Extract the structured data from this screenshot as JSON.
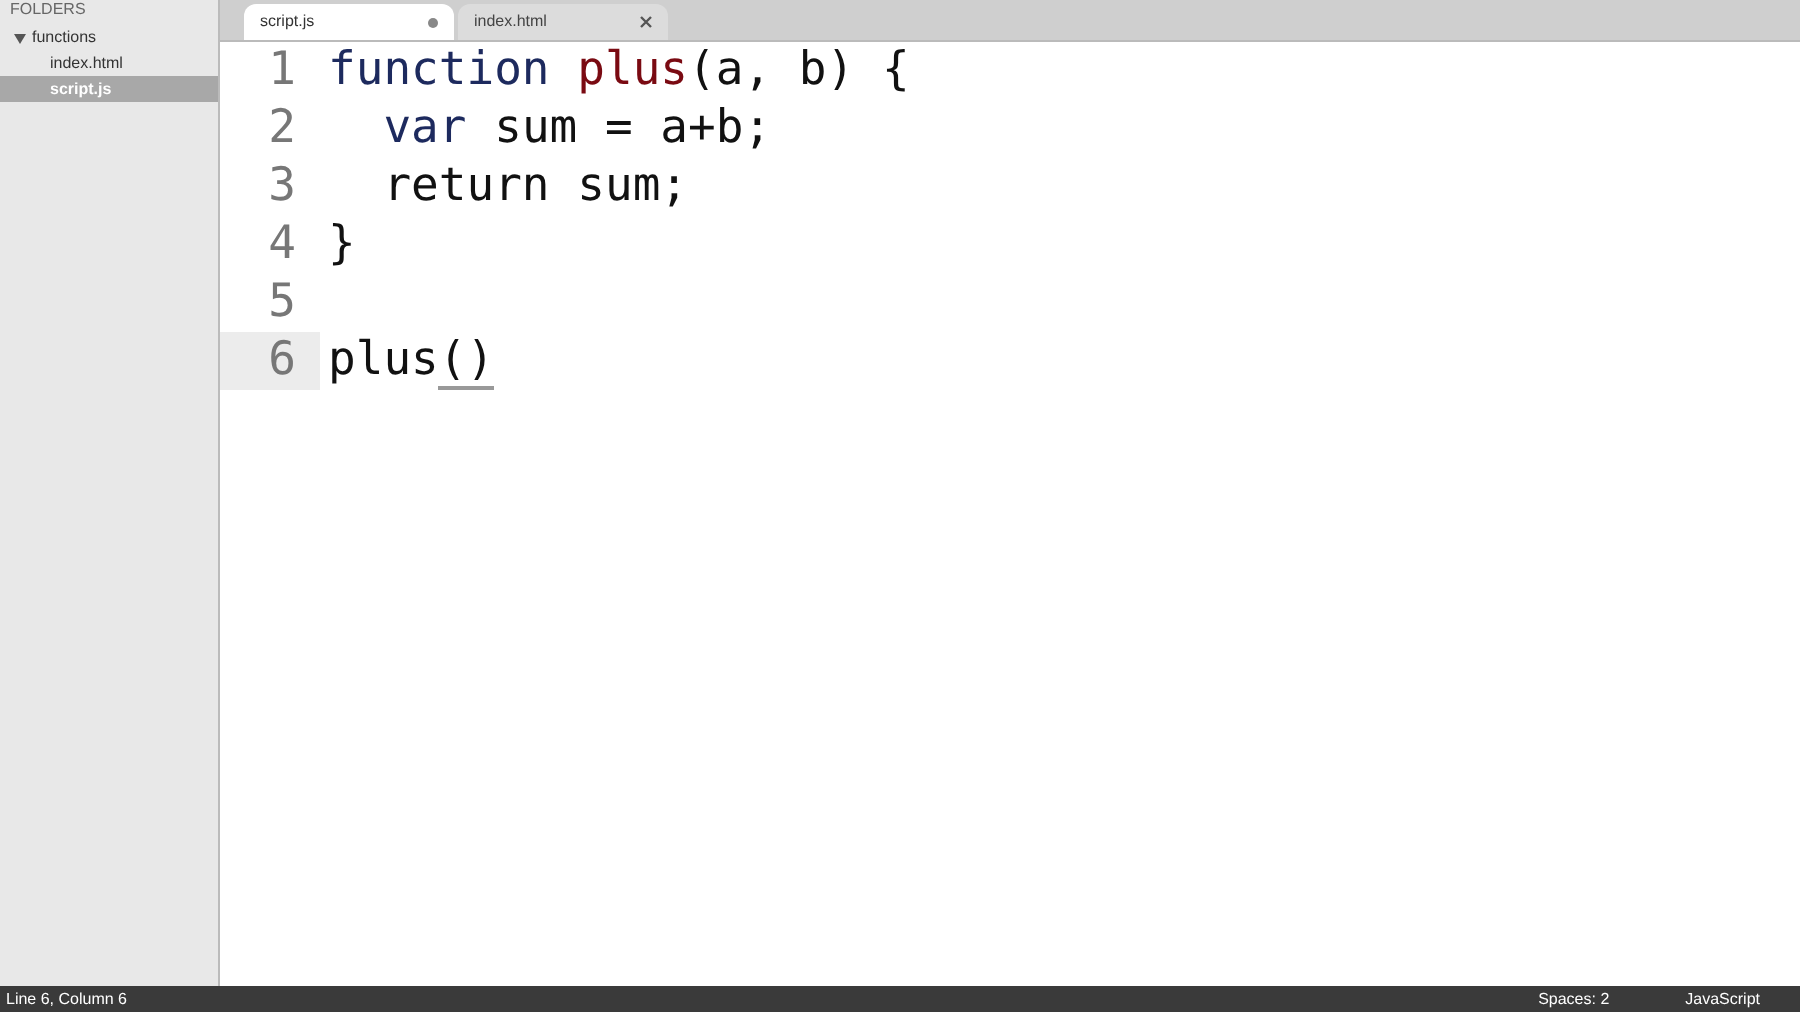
{
  "sidebar": {
    "header": "FOLDERS",
    "tree": [
      {
        "label": "functions",
        "expanded": true,
        "selected": false,
        "children": [
          {
            "label": "index.html",
            "selected": false
          },
          {
            "label": "script.js",
            "selected": true
          }
        ]
      }
    ]
  },
  "tabs": [
    {
      "label": "script.js",
      "selected": true,
      "dirty": true
    },
    {
      "label": "index.html",
      "selected": false,
      "dirty": false
    }
  ],
  "editor": {
    "lines": [
      {
        "number": "1",
        "current": false,
        "tokens": [
          {
            "kind": "keyword",
            "text": "function "
          },
          {
            "kind": "name",
            "text": "plus"
          },
          {
            "kind": "plain",
            "text": "(a, b) {"
          }
        ]
      },
      {
        "number": "2",
        "current": false,
        "tokens": [
          {
            "kind": "keyword",
            "text": "  var"
          },
          {
            "kind": "plain",
            "text": " sum = a+b;"
          }
        ]
      },
      {
        "number": "3",
        "current": false,
        "tokens": [
          {
            "kind": "plain",
            "text": "  return sum;"
          }
        ]
      },
      {
        "number": "4",
        "current": false,
        "tokens": [
          {
            "kind": "plain",
            "text": "}"
          }
        ]
      },
      {
        "number": "5",
        "current": false
      },
      {
        "number": "6",
        "current": true,
        "tokens": [
          {
            "kind": "plain",
            "text": "plus"
          },
          {
            "kind": "matched",
            "text": "()"
          }
        ]
      }
    ]
  },
  "status_bar": {
    "position": "Line 6, Column 6",
    "indentation": "Spaces: 2",
    "syntax": "JavaScript"
  }
}
